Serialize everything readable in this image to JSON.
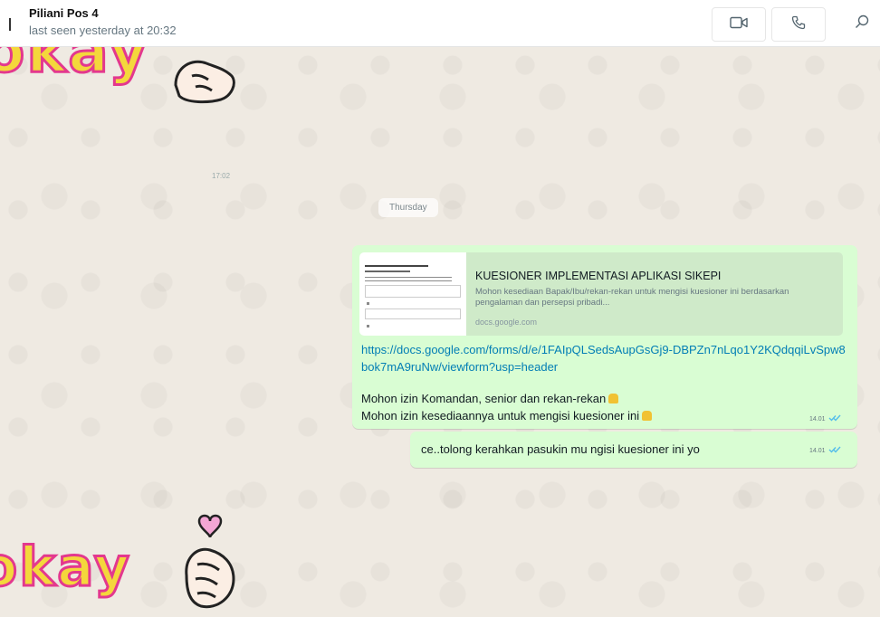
{
  "header": {
    "contact_name": "Piliani Pos 4",
    "last_seen": "last seen yesterday at 20:32",
    "icons": [
      "video-call-icon",
      "voice-call-icon",
      "search-icon"
    ]
  },
  "stickers": {
    "top": "okay",
    "bottom": "okay"
  },
  "chat": {
    "faint_time": "17:02",
    "date_divider": "Thursday",
    "messages": [
      {
        "preview": {
          "title": "KUESIONER IMPLEMENTASI APLIKASI SIKEPI",
          "description": "Mohon kesediaan Bapak/Ibu/rekan-rekan untuk mengisi kuesioner ini berdasarkan pengalaman dan persepsi pribadi...",
          "domain": "docs.google.com"
        },
        "link": "https://docs.google.com/forms/d/e/1FAIpQLSedsAupGsGj9-DBPZn7nLqo1Y2KQdqqiLvSpw8bok7mA9ruNw/viewform?usp=header",
        "line1": "Mohon izin Komandan, senior dan rekan-rekan",
        "line2": "Mohon izin kesediaannya untuk mengisi kuesioner ini",
        "time": "14.01",
        "status": "read"
      },
      {
        "text": "ce..tolong kerahkan pasukin mu ngisi kuesioner ini yo",
        "time": "14.01",
        "status": "read"
      }
    ]
  },
  "colors": {
    "outgoing_bubble": "#d9fdd3",
    "link": "#027eb5",
    "wallpaper": "#efeae2",
    "read_ticks": "#53bdeb"
  }
}
